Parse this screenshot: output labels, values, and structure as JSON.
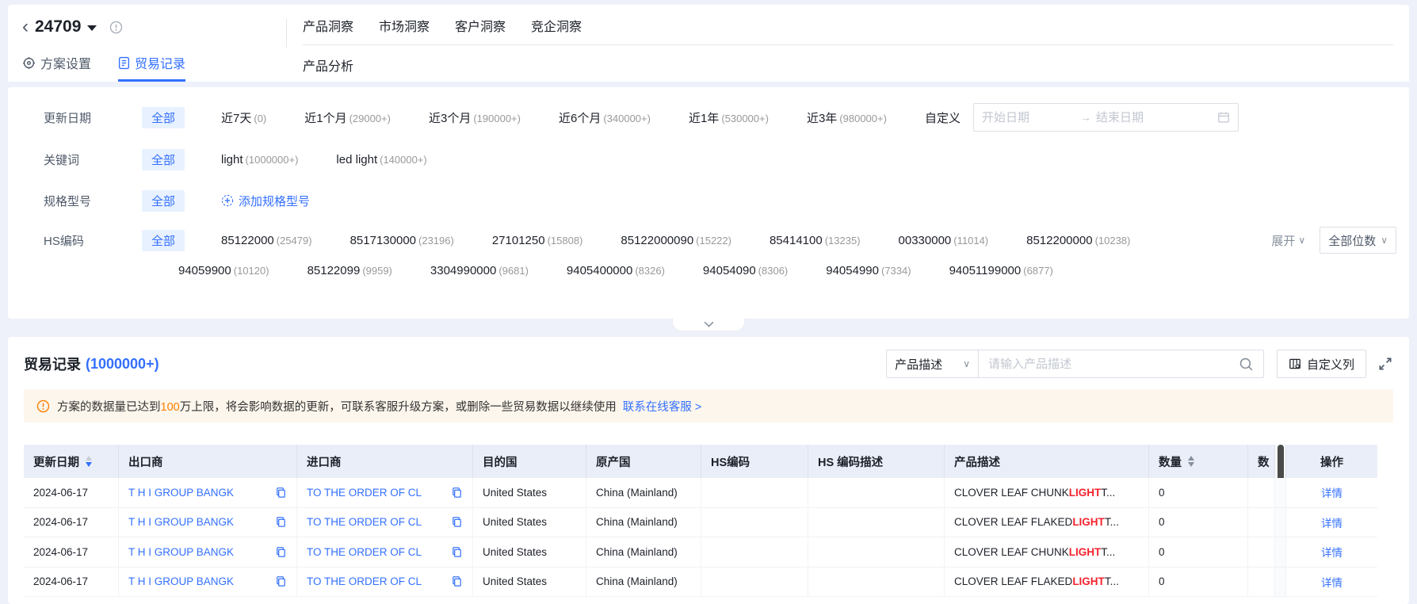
{
  "header": {
    "back_icon": "‹",
    "plan_id": "24709",
    "tab_settings": "方案设置",
    "tab_records": "贸易记录",
    "nav": [
      {
        "label": "产品洞察"
      },
      {
        "label": "市场洞察"
      },
      {
        "label": "客户洞察"
      },
      {
        "label": "竞企洞察"
      }
    ],
    "subnav": "产品分析"
  },
  "filters": {
    "update_date": {
      "label": "更新日期",
      "all": "全部",
      "options": [
        {
          "text": "近7天",
          "count": "(0)"
        },
        {
          "text": "近1个月",
          "count": "(29000+)"
        },
        {
          "text": "近3个月",
          "count": "(190000+)"
        },
        {
          "text": "近6个月",
          "count": "(340000+)"
        },
        {
          "text": "近1年",
          "count": "(530000+)"
        },
        {
          "text": "近3年",
          "count": "(980000+)"
        }
      ],
      "custom_label": "自定义",
      "start_placeholder": "开始日期",
      "end_placeholder": "结束日期"
    },
    "keyword": {
      "label": "关键词",
      "all": "全部",
      "options": [
        {
          "text": "light",
          "count": "(1000000+)"
        },
        {
          "text": "led light",
          "count": "(140000+)"
        }
      ]
    },
    "spec": {
      "label": "规格型号",
      "all": "全部",
      "add_label": "添加规格型号"
    },
    "hs_code": {
      "label": "HS编码",
      "all": "全部",
      "line1": [
        {
          "code": "85122000",
          "count": "(25479)"
        },
        {
          "code": "8517130000",
          "count": "(23196)"
        },
        {
          "code": "27101250",
          "count": "(15808)"
        },
        {
          "code": "85122000090",
          "count": "(15222)"
        },
        {
          "code": "85414100",
          "count": "(13235)"
        },
        {
          "code": "00330000",
          "count": "(11014)"
        },
        {
          "code": "8512200000",
          "count": "(10238)"
        }
      ],
      "line2": [
        {
          "code": "94059900",
          "count": "(10120)"
        },
        {
          "code": "85122099",
          "count": "(9959)"
        },
        {
          "code": "3304990000",
          "count": "(9681)"
        },
        {
          "code": "9405400000",
          "count": "(8326)"
        },
        {
          "code": "94054090",
          "count": "(8306)"
        },
        {
          "code": "94054990",
          "count": "(7334)"
        },
        {
          "code": "94051199000",
          "count": "(6877)"
        }
      ],
      "expand_label": "展开",
      "digits_label": "全部位数"
    }
  },
  "records": {
    "title": "贸易记录",
    "count": "(1000000+)",
    "search_field": "产品描述",
    "search_placeholder": "请输入产品描述",
    "customize_label": "自定义列",
    "notice": {
      "text_before": "方案的数据量已达到",
      "highlight": "100",
      "text_after": "万上限，将会影响数据的更新，可联系客服升级方案，或删除一些贸易数据以继续使用",
      "link": "联系在线客服 >"
    },
    "table": {
      "headers": [
        "更新日期",
        "出口商",
        "进口商",
        "目的国",
        "原产国",
        "HS编码",
        "HS 编码描述",
        "产品描述",
        "数量",
        "数",
        "操作"
      ],
      "rows": [
        {
          "date": "2024-06-17",
          "exporter": "T H I GROUP BANGK",
          "importer": "TO THE ORDER OF CL",
          "destination": "United States",
          "origin": "China (Mainland)",
          "hs_code": "",
          "hs_desc": "",
          "product_before": "CLOVER LEAF CHUNK ",
          "product_keyword": "LIGHT",
          "product_after": " T...",
          "quantity": "0",
          "action": "详情"
        },
        {
          "date": "2024-06-17",
          "exporter": "T H I GROUP BANGK",
          "importer": "TO THE ORDER OF CL",
          "destination": "United States",
          "origin": "China (Mainland)",
          "hs_code": "",
          "hs_desc": "",
          "product_before": "CLOVER LEAF FLAKED ",
          "product_keyword": "LIGHT",
          "product_after": " T...",
          "quantity": "0",
          "action": "详情"
        },
        {
          "date": "2024-06-17",
          "exporter": "T H I GROUP BANGK",
          "importer": "TO THE ORDER OF CL",
          "destination": "United States",
          "origin": "China (Mainland)",
          "hs_code": "",
          "hs_desc": "",
          "product_before": "CLOVER LEAF CHUNK ",
          "product_keyword": "LIGHT",
          "product_after": " T...",
          "quantity": "0",
          "action": "详情"
        },
        {
          "date": "2024-06-17",
          "exporter": "T H I GROUP BANGK",
          "importer": "TO THE ORDER OF CL",
          "destination": "United States",
          "origin": "China (Mainland)",
          "hs_code": "",
          "hs_desc": "",
          "product_before": "CLOVER LEAF FLAKED ",
          "product_keyword": "LIGHT",
          "product_after": " T...",
          "quantity": "0",
          "action": "详情"
        }
      ]
    }
  }
}
